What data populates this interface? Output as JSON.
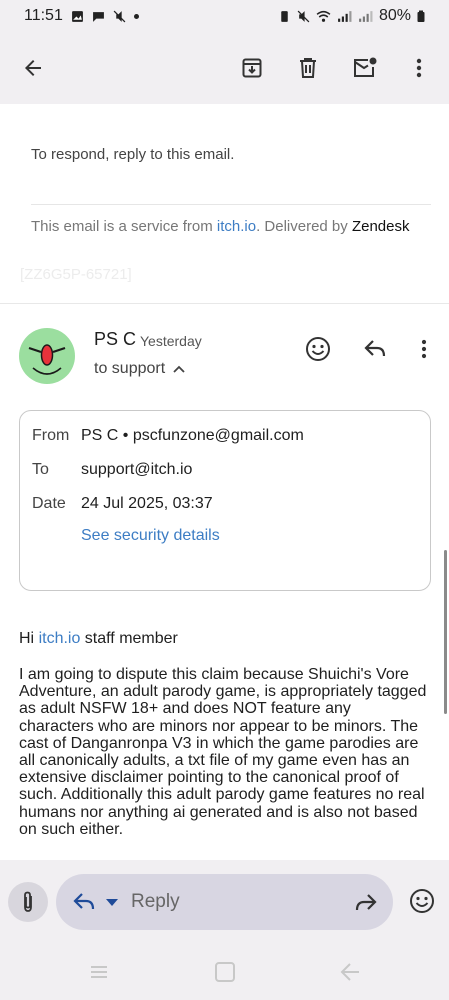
{
  "status_bar": {
    "time": "11:51",
    "battery": "80%"
  },
  "toolbar": {
    "back_icon": "arrow-back-icon",
    "archive_icon": "archive-icon",
    "delete_icon": "trash-icon",
    "mark_unread_icon": "mark-unread-icon",
    "more_icon": "more-vert-icon"
  },
  "quoted": {
    "respond_text": "To respond, reply to this email.",
    "footer_prefix": "This email is a service from ",
    "footer_link": "itch.io",
    "footer_middle": ". Delivered by ",
    "footer_brand": "Zendesk",
    "ticket_id": "[ZZ6G5P-65721]"
  },
  "message": {
    "sender_name": "PS C",
    "time": "Yesterday",
    "to_line": "to support",
    "details": {
      "from_label": "From",
      "from_value": "PS C • pscfunzone@gmail.com",
      "to_label": "To",
      "to_value": "support@itch.io",
      "date_label": "Date",
      "date_value": "24 Jul 2025, 03:37",
      "security_link": "See security details"
    },
    "greeting_prefix": "Hi ",
    "greeting_link": "itch.io",
    "greeting_suffix": " staff member",
    "body": "I am going to dispute this claim because Shuichi's Vore Adventure, an adult parody game, is appropriately tagged as adult NSFW 18+ and does NOT feature any characters who are minors nor appear to be minors. The cast of Danganronpa V3 in which the game parodies are all canonically adults, a txt file of my game even has an extensive disclaimer pointing to the canonical proof of such. Additionally this adult parody game features no real humans nor anything ai generated and is also not based on such either."
  },
  "reply_bar": {
    "placeholder": "Reply"
  },
  "colors": {
    "link": "#3d7dc4",
    "avatar_bg": "#9bde9f",
    "bar_bg": "#f1eff2"
  }
}
